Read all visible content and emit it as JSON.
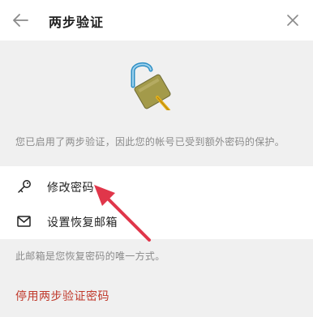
{
  "header": {
    "title": "两步验证",
    "back_icon": "arrow-left-icon",
    "close_icon": "close-icon"
  },
  "hero": {
    "icon": "unlocked-padlock-icon",
    "text": "您已启用了两步验证，因此您的帐号已受到额外密码的保护。"
  },
  "options": [
    {
      "icon": "key-icon",
      "label": "修改密码"
    },
    {
      "icon": "envelope-icon",
      "label": "设置恢复邮箱"
    }
  ],
  "note": "此邮箱是您恢复密码的唯一方式。",
  "footer": {
    "disable_label": "停用两步验证密码"
  },
  "colors": {
    "accent_red": "#c0392b",
    "annotation_arrow": "#e0364a",
    "panel_gray": "#f0f0f0"
  }
}
